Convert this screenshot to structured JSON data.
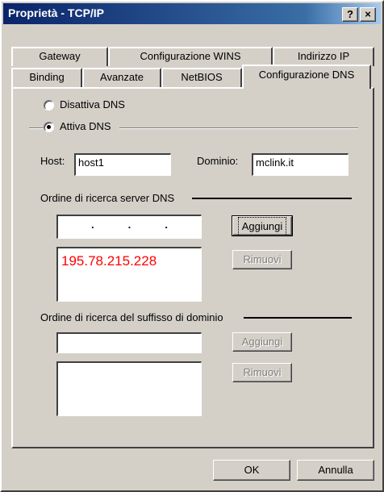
{
  "window": {
    "title": "Proprietà - TCP/IP",
    "help_label": "?",
    "close_label": "×"
  },
  "tabs_back": [
    {
      "label": "Gateway"
    },
    {
      "label": "Configurazione WINS"
    },
    {
      "label": "Indirizzo IP"
    }
  ],
  "tabs_front": [
    {
      "label": "Binding"
    },
    {
      "label": "Avanzate"
    },
    {
      "label": "NetBIOS"
    },
    {
      "label": "Configurazione DNS"
    }
  ],
  "dns": {
    "disable_label": "Disattiva DNS",
    "enable_label": "Attiva DNS",
    "selected": "enable",
    "host_label": "Host:",
    "host_value": "host1",
    "domain_label": "Dominio:",
    "domain_value": "mclink.it"
  },
  "server_order": {
    "heading": "Ordine di ricerca server DNS",
    "ip_dots": [
      ".",
      ".",
      "."
    ],
    "entries": [
      "195.78.215.228"
    ],
    "add_label": "Aggiungi",
    "remove_label": "Rimuovi"
  },
  "suffix_order": {
    "heading": "Ordine di ricerca del suffisso di dominio",
    "input_value": "",
    "add_label": "Aggiungi",
    "remove_label": "Rimuovi"
  },
  "footer": {
    "ok_label": "OK",
    "cancel_label": "Annulla"
  },
  "colors": {
    "title_bar": "#0a246a",
    "entry_text": "#ff0000",
    "face": "#d4d0c8"
  }
}
